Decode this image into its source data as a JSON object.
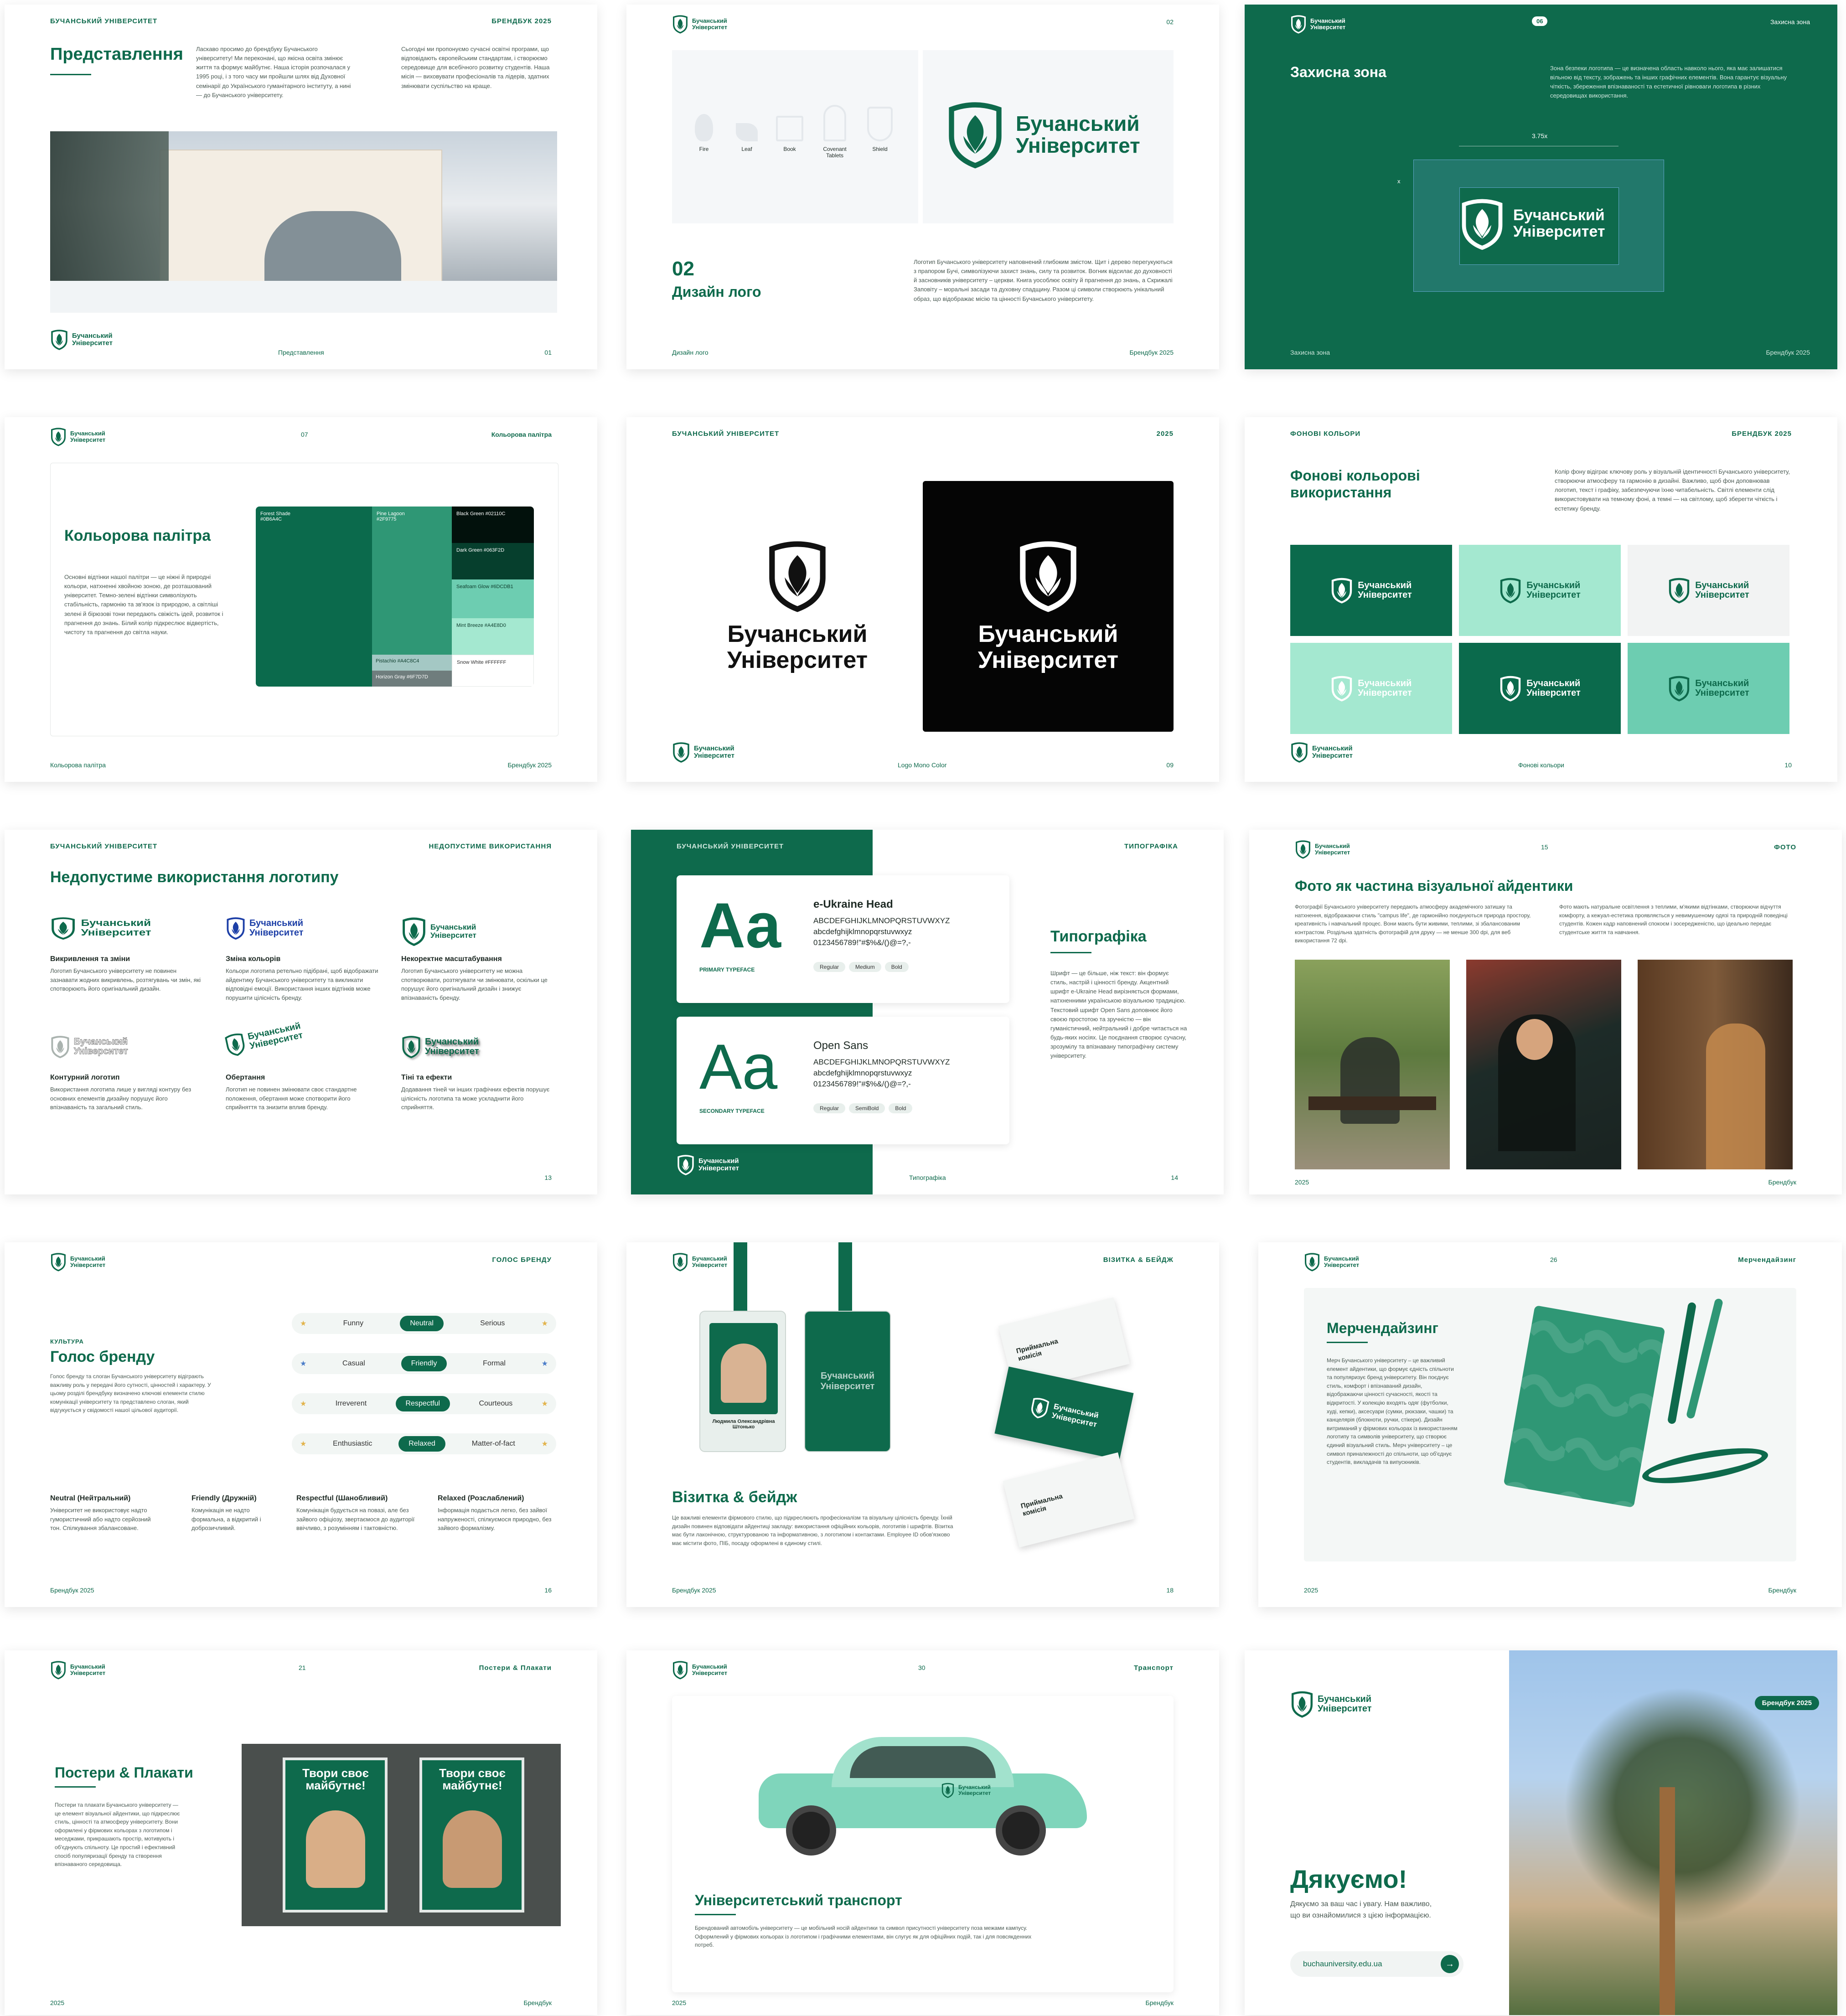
{
  "brand": {
    "logo_line": "Бучанський\nУніверситет",
    "uni_caps": "БУЧАНСЬКИЙ УНІВЕРСИТЕТ",
    "book": "БРЕНДБУК 2025",
    "year": "2025",
    "brandbook": "Брендбук",
    "brandbook_year": "Брендбук 2025"
  },
  "s1": {
    "title": "Представлення",
    "p1": "Ласкаво просимо до брендбуку Бучанського університету! Ми переконані, що якісна освіта змінює життя та формує майбутнє. Наша історія розпочалася у 1995 році, і з того часу ми пройшли шлях від Духовної семінарії до Українського гуманітарного інституту, а нині — до Бучанського університету.",
    "p2": "Сьогодні ми пропонуємо сучасні освітні програми, що відповідають європейським стандартам, і створюємо середовище для всебічного розвитку студентів. Наша місія — виховувати професіоналів та лідерів, здатних змінювати суспільство на краще.",
    "foot": "Представлення",
    "num": "01"
  },
  "s2": {
    "num_top": "02",
    "icons": [
      "Fire",
      "Leaf",
      "Book",
      "Covenant Tablets",
      "Shield"
    ],
    "big_num": "02",
    "title": "Дизайн лого",
    "p": "Логотип Бучанського університету наповнений глибоким змістом. Щит і дерево перегукуються з прапором Бучі, символізуючи захист знань, силу та розвиток. Вогник відсилає до духовності й засновників університету – церкви. Книга уособлює освіту й прагнення до знань, а Скрижалі Заповіту – моральні засади та духовну спадщину. Разом ці символи створюють унікальний образ, що відображає місію та цінності Бучанського університету.",
    "foot": "Дизайн лого",
    "foot_r": "Брендбук 2025"
  },
  "s3": {
    "badge": "06",
    "top_r": "Захисна зона",
    "title": "Захисна зона",
    "p": "Зона безпеки логотипа — це визначена область навколо нього, яка має залишатися вільною від тексту, зображень та інших графічних елементів. Вона гарантує візуальну чіткість, збереження впізнаваності та естетичної рівноваги логотипа в різних середовищах використання.",
    "dim": "3.75x",
    "x": "x",
    "foot": "Захисна зона",
    "foot_r": "Брендбук 2025"
  },
  "s4": {
    "num": "07",
    "top_r": "Кольорова палітра",
    "title": "Кольорова палітра",
    "p": "Основні відтінки нашої палітри — це ніжні й природні кольори, натхненні хвойною зоною, де розташований університет. Темно-зелені відтінки символізують стабільність, гармонію та зв'язок із природою, а світліші зелені й бірюзові тони передають свіжість ідей, розвиток і прагнення до знань. Білий колір підкреслює відвертість, чистоту та прагнення до світла науки.",
    "swatches": [
      {
        "name": "Forest Shade",
        "hex": "#0B6A4C",
        "color": "#0b6a4c"
      },
      {
        "name": "Pine Lagoon",
        "hex": "#2F9775",
        "color": "#2f9775"
      },
      {
        "name": "Black Green",
        "hex": "#02110C",
        "color": "#02110c"
      },
      {
        "name": "Dark Green",
        "hex": "#063F2D",
        "color": "#063f2d"
      },
      {
        "name": "Seafoam Glow",
        "hex": "#6DCDB1",
        "color": "#6dcdb1"
      },
      {
        "name": "Mint Breeze",
        "hex": "#A4E8D0",
        "color": "#a4e8d0"
      },
      {
        "name": "Pistachio",
        "hex": "#A4C8C4",
        "color": "#a4c8c4"
      },
      {
        "name": "Horizon Gray",
        "hex": "#6F7D7D",
        "color": "#6f7d7d"
      },
      {
        "name": "Snow White",
        "hex": "#FFFFFF",
        "color": "#ffffff"
      }
    ],
    "foot": "Кольорова палітра",
    "foot_r": "Брендбук 2025"
  },
  "s5": {
    "top_r": "2025",
    "foot": "Logo Mono Color",
    "num": "09"
  },
  "s6": {
    "top_l": "ФОНОВІ КОЛЬОРИ",
    "title": "Фонові кольорові використання",
    "p": "Колір фону відіграє ключову роль у візуальній ідентичності Бучанського університету, створюючи атмосферу та гармонію в дизайні. Важливо, щоб фон доповнював логотип, текст і графіку, забезпечуючи їхню читабельність. Світлі елементи слід використовувати на темному фоні, а темні — на світлому, щоб зберегти чіткість і естетику бренду.",
    "foot": "Фонові кольори",
    "num": "10"
  },
  "s7": {
    "top_r": "НЕДОПУСТИМЕ ВИКОРИСТАННЯ",
    "title": "Недопустиме використання логотипу",
    "items": [
      {
        "t": "Викривлення та зміни",
        "d": "Логотип Бучанського університету не повинен зазнавати жодних викривлень, розтягувань чи змін, які спотворюють його оригінальний дизайн."
      },
      {
        "t": "Зміна кольорів",
        "d": "Кольори логотипа ретельно підібрані, щоб відображати айдентику Бучанського університету та викликати відповідні емоції. Використання інших відтінків може порушити цілісність бренду."
      },
      {
        "t": "Некоректне масштабування",
        "d": "Логотип Бучанського університету не можна спотворювати, розтягувати чи змінювати, оскільки це порушує його оригінальний дизайн і знижує впізнаваність бренду."
      },
      {
        "t": "Контурний логотип",
        "d": "Використання логотипа лише у вигляді контуру без основних елементів дизайну порушує його впізнаваність та загальний стиль."
      },
      {
        "t": "Обертання",
        "d": "Логотип не повинен змінювати своє стандартне положення, обертання може спотворити його сприйняття та знизити вплив бренду."
      },
      {
        "t": "Тіні та ефекти",
        "d": "Додавання тіней чи інших графічних ефектів порушує цілісність логотипа та може ускладнити його сприйняття."
      }
    ],
    "num": "13"
  },
  "s8": {
    "top_l": "БУЧАНСЬКИЙ УНІВЕРСИТЕТ",
    "top_r": "ТИПОГРАФІКА",
    "f1": "e-Ukraine Head",
    "f1_label": "PRIMARY TYPEFACE",
    "f2": "Open Sans",
    "f2_label": "SECONDARY TYPEFACE",
    "upper": "ABCDEFGHIJKLMNOPQRSTUVWXYZ",
    "lower": "abcdefghijklmnopqrstuvwxyz",
    "nums": "0123456789!\"#$%&/()@=?,-",
    "aa": "Aa",
    "w1": [
      "Regular",
      "Medium",
      "Bold"
    ],
    "w2": [
      "Regular",
      "SemiBold",
      "Bold"
    ],
    "title": "Типографіка",
    "p": "Шрифт — це більше, ніж текст: він формує стиль, настрій і цінності бренду. Акцентний шрифт e-Ukraine Head вирізняється формами, натхненними українською візуальною традицією. Текстовий шрифт Open Sans доповнює його своєю простотою та зручністю — він гуманістичний, нейтральний і добре читається на будь-яких носіях. Це поєднання створює сучасну, зрозумілу та впізнавану типографічну систему університету.",
    "foot": "Типографіка",
    "num": "14"
  },
  "s9": {
    "num": "15",
    "top_r": "ФОТО",
    "title": "Фото як частина візуальної айдентики",
    "p1": "Фотографії Бучанського університету передають атмосферу академічного затишку та натхнення, відображаючи стиль \"campus life\", де гармонійно поєднуються природа простору, креативність і навчальний процес. Вони мають бути живими, теплими, зі збалансованим контрастом. Роздільна здатність фотографій для друку — не менше 300 dpi, для веб використання 72 dpi.",
    "p2": "Фото мають натуральне освітлення з теплими, м'якими відтінками, створюючи відчуття комфорту, а кежуал-естетика проявляється у невимушеному одязі та природній поведінці студентів. Кожен кадр наповнений спокоєм і зосередженістю, що ідеально передає студентське життя та навчання.",
    "foot_l": "2025",
    "foot_r": "Брендбук"
  },
  "s10": {
    "top_r": "ГОЛОС БРЕНДУ",
    "kicker": "КУЛЬТУРА",
    "title": "Голос бренду",
    "p": "Голос бренду та слоган Бучанського університету відіграють важливу роль у передачі його сутності, цінностей і характеру. У цьому розділі брендбуку визначено ключові елементи стилю комунікації університету та представлено слоган, який відгукується у свідомості нашої цільової аудиторії.",
    "rows": [
      {
        "l": "Funny",
        "m": "Neutral",
        "r": "Serious"
      },
      {
        "l": "Casual",
        "m": "Friendly",
        "r": "Formal"
      },
      {
        "l": "Irreverent",
        "m": "Respectful",
        "r": "Courteous"
      },
      {
        "l": "Enthusiastic",
        "m": "Relaxed",
        "r": "Matter-of-fact"
      }
    ],
    "cols": [
      {
        "t": "Neutral (Нейтральний)",
        "d": "Університет не використовує надто гумористичний або надто серйозний тон. Спілкування збалансоване."
      },
      {
        "t": "Friendly (Дружній)",
        "d": "Комунікація не надто формальна, а відкритий і доброзичливий."
      },
      {
        "t": "Respectful (Шанобливий)",
        "d": "Комунікація будується на повазі, але без зайвого офіціозу, звертаємося до аудиторії ввічливо, з розумінням і тактовністю."
      },
      {
        "t": "Relaxed (Розслаблений)",
        "d": "Інформація подається легко, без зайвої напруженості, спілкуємося природно, без зайвого формалізму."
      }
    ],
    "foot": "Брендбук 2025",
    "num": "16"
  },
  "s11": {
    "top_r": "ВІЗИТКА & БЕЙДЖ",
    "title": "Візитка & бейдж",
    "p": "Це важливі елементи фірмового стилю, що підкреслюють професіоналізм та візуальну цілісність бренду. Їхній дизайн повинен відповідати айдентиці закладу: використання офіційних кольорів, логотипів і шрифтів. Візитка має бути лаконічною, структурованою та інформативною, з логотипом і контактами. Employee ID обов'язково має містити фото, ПІБ, посаду оформлені в єдиному стилі.",
    "name": "Людмила Олександрівна Штонько",
    "card": "Приймальна комісія",
    "foot": "Брендбук 2025",
    "num": "18"
  },
  "s12": {
    "num": "26",
    "top_r": "Мерчендайзинг",
    "title": "Мерчендайзинг",
    "p": "Мерч Бучанського університету – це важливий елемент айдентики, що формує єдність спільноти та популяризує бренд університету. Він поєднує стиль, комфорт і впізнаваний дизайн, відображаючи цінності сучасності, якості та відкритості. У колекцію входять одяг (футболки, худі, кепки), аксесуари (сумки, рюкзаки, чашки) та канцелярія (блокноти, ручки, стікери). Дизайн витриманий у фірмових кольорах із використанням логотипу та символів університету, що створює єдиний візуальний стиль. Мерч університету – це символ приналежності до спільноти, що об'єднує студентів, викладачів та випускників.",
    "foot_l": "2025",
    "foot_r": "Брендбук"
  },
  "s13": {
    "num": "21",
    "top_r": "Постери & Плакати",
    "title": "Постери & Плакати",
    "p": "Постери та плакати Бучанського університету — це елемент візуальної айдентики, що підкреслює стиль, цінності та атмосферу університету. Вони оформлені у фірмових кольорах з логотипом і меседжами, прикрашають простір, мотивують і об'єднують спільноту. Це простий і ефективний спосіб популяризації бренду та створення впізнаваного середовища.",
    "slogan": "Твори своє майбутнє!",
    "foot_l": "2025",
    "foot_r": "Брендбук"
  },
  "s14": {
    "num": "30",
    "top_r": "Транспорт",
    "title": "Університетський транспорт",
    "p": "Брендований автомобіль університету — це мобільний носій айдентики та символ присутності університету поза межами кампусу. Оформлений у фірмових кольорах із логотипом і графічними елементами, він слугує як для офіційних подій, так і для повсякденних потреб.",
    "foot_l": "2025",
    "foot_r": "Брендбук"
  },
  "s15": {
    "badge": "Брендбук 2025",
    "title": "Дякуємо!",
    "p": "Дякуємо за ваш час і увагу. Нам важливо, що ви ознайомилися з цією інформацією.",
    "url": "buchauniversity.edu.ua"
  }
}
